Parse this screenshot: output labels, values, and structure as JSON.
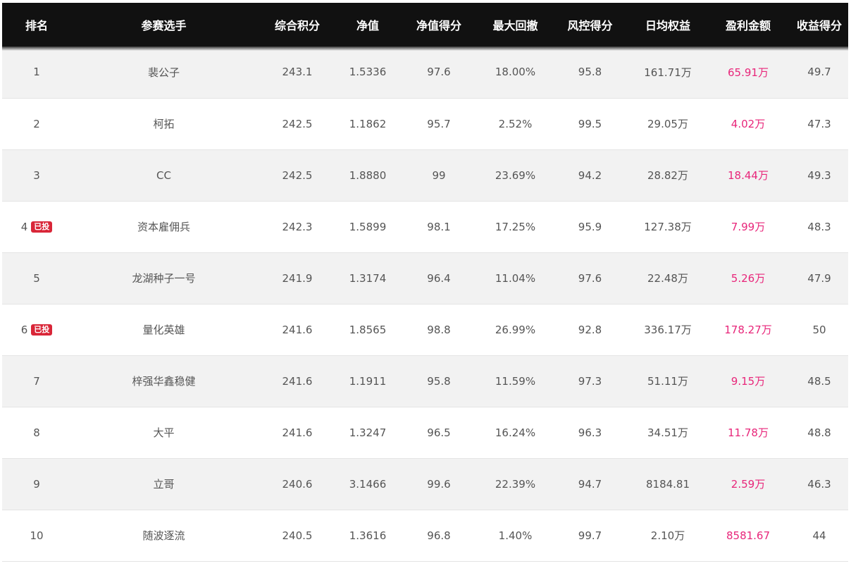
{
  "columns": [
    "排名",
    "参赛选手",
    "综合积分",
    "净值",
    "净值得分",
    "最大回撤",
    "风控得分",
    "日均权益",
    "盈利金额",
    "收益得分"
  ],
  "rows": [
    {
      "rank": "1",
      "badge": "",
      "name": "裴公子",
      "score": "243.1",
      "nav": "1.5336",
      "nav_score": "97.6",
      "max_drawdown": "18.00%",
      "risk_score": "95.8",
      "avg_equity": "161.71万",
      "profit": "65.91万",
      "return_score": "49.7"
    },
    {
      "rank": "2",
      "badge": "",
      "name": "柯拓",
      "score": "242.5",
      "nav": "1.1862",
      "nav_score": "95.7",
      "max_drawdown": "2.52%",
      "risk_score": "99.5",
      "avg_equity": "29.05万",
      "profit": "4.02万",
      "return_score": "47.3"
    },
    {
      "rank": "3",
      "badge": "",
      "name": "CC",
      "score": "242.5",
      "nav": "1.8880",
      "nav_score": "99",
      "max_drawdown": "23.69%",
      "risk_score": "94.2",
      "avg_equity": "28.82万",
      "profit": "18.44万",
      "return_score": "49.3"
    },
    {
      "rank": "4",
      "badge": "已投",
      "name": "资本雇佣兵",
      "score": "242.3",
      "nav": "1.5899",
      "nav_score": "98.1",
      "max_drawdown": "17.25%",
      "risk_score": "95.9",
      "avg_equity": "127.38万",
      "profit": "7.99万",
      "return_score": "48.3"
    },
    {
      "rank": "5",
      "badge": "",
      "name": "龙湖种子一号",
      "score": "241.9",
      "nav": "1.3174",
      "nav_score": "96.4",
      "max_drawdown": "11.04%",
      "risk_score": "97.6",
      "avg_equity": "22.48万",
      "profit": "5.26万",
      "return_score": "47.9"
    },
    {
      "rank": "6",
      "badge": "已投",
      "name": "量化英雄",
      "score": "241.6",
      "nav": "1.8565",
      "nav_score": "98.8",
      "max_drawdown": "26.99%",
      "risk_score": "92.8",
      "avg_equity": "336.17万",
      "profit": "178.27万",
      "return_score": "50"
    },
    {
      "rank": "7",
      "badge": "",
      "name": "梓强华鑫稳健",
      "score": "241.6",
      "nav": "1.1911",
      "nav_score": "95.8",
      "max_drawdown": "11.59%",
      "risk_score": "97.3",
      "avg_equity": "51.11万",
      "profit": "9.15万",
      "return_score": "48.5"
    },
    {
      "rank": "8",
      "badge": "",
      "name": "大平",
      "score": "241.6",
      "nav": "1.3247",
      "nav_score": "96.5",
      "max_drawdown": "16.24%",
      "risk_score": "96.3",
      "avg_equity": "34.51万",
      "profit": "11.78万",
      "return_score": "48.8"
    },
    {
      "rank": "9",
      "badge": "",
      "name": "立哥",
      "score": "240.6",
      "nav": "3.1466",
      "nav_score": "99.6",
      "max_drawdown": "22.39%",
      "risk_score": "94.7",
      "avg_equity": "8184.81",
      "profit": "2.59万",
      "return_score": "46.3"
    },
    {
      "rank": "10",
      "badge": "",
      "name": "随波逐流",
      "score": "240.5",
      "nav": "1.3616",
      "nav_score": "96.8",
      "max_drawdown": "1.40%",
      "risk_score": "99.7",
      "avg_equity": "2.10万",
      "profit": "8581.67",
      "return_score": "44"
    }
  ],
  "colors": {
    "header_bg": "#111111",
    "header_text": "#ffffff",
    "row_alt_bg": "#f2f2f2",
    "body_text": "#555555",
    "profit_text": "#e8267a",
    "badge_bg": "#d92638"
  }
}
